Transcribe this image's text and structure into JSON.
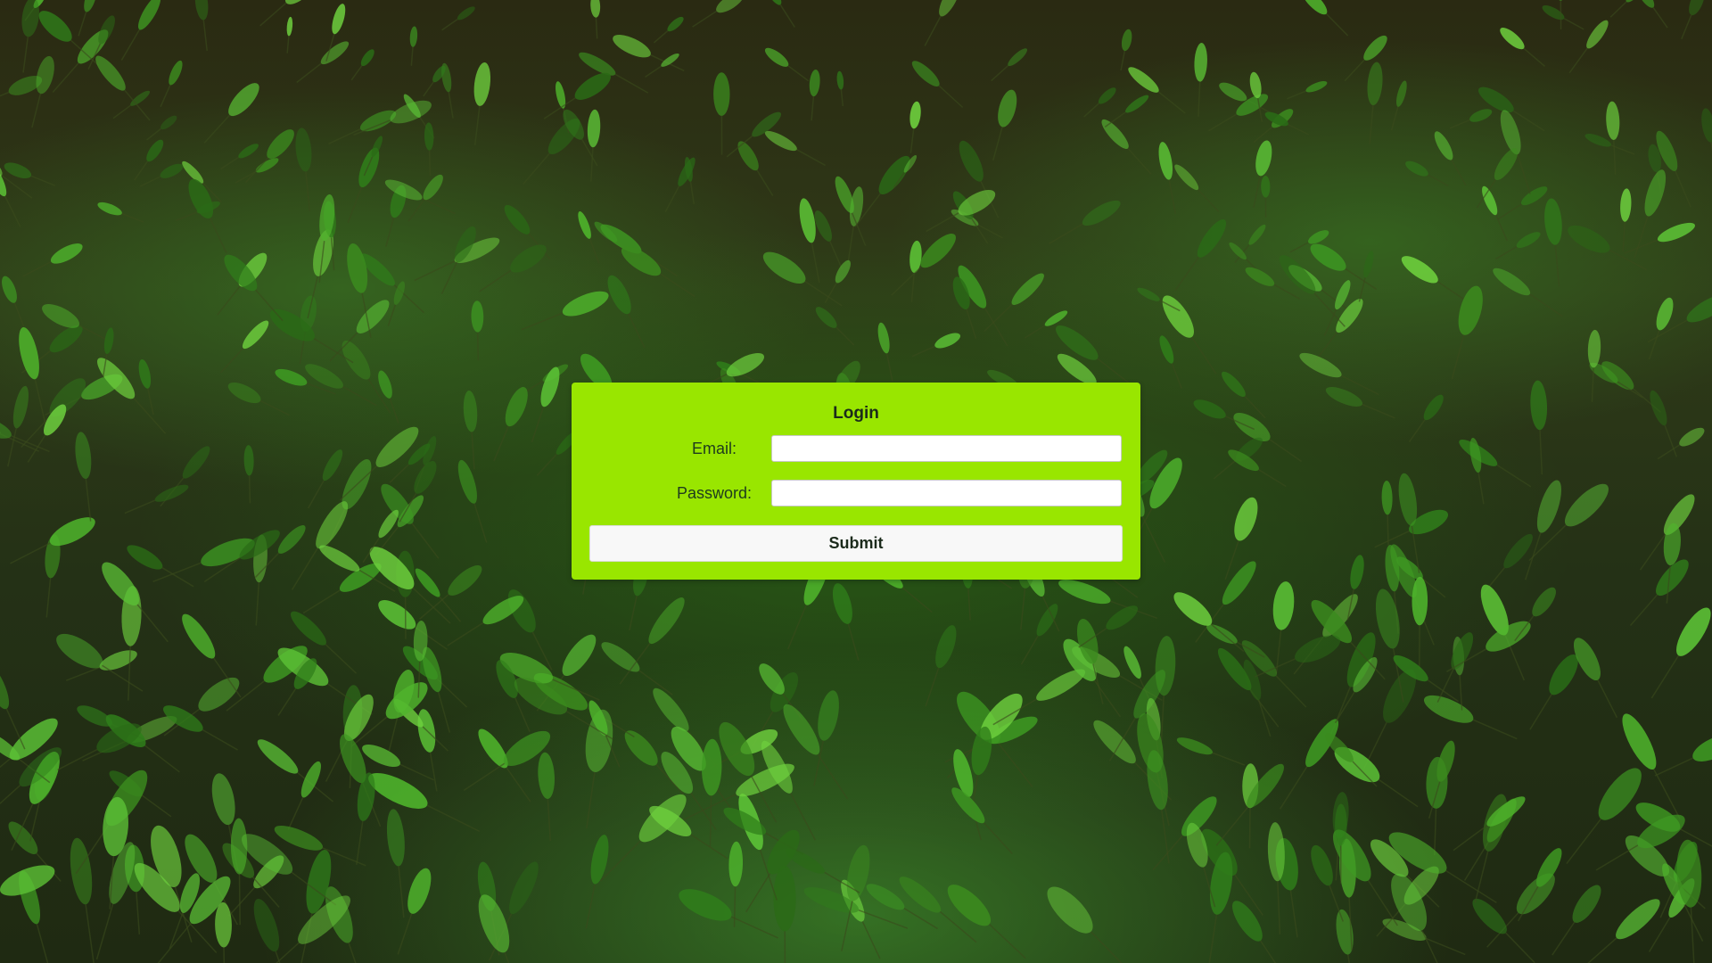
{
  "background": {
    "description_icon": "seedlings-background-photo",
    "colors": [
      "#2a2a12",
      "#3a8a20",
      "#5cc030"
    ]
  },
  "login": {
    "title": "Login",
    "email_label": "Email:",
    "email_value": "",
    "password_label": "Password:",
    "password_value": "",
    "submit_label": "Submit",
    "card_color": "#99e600"
  }
}
